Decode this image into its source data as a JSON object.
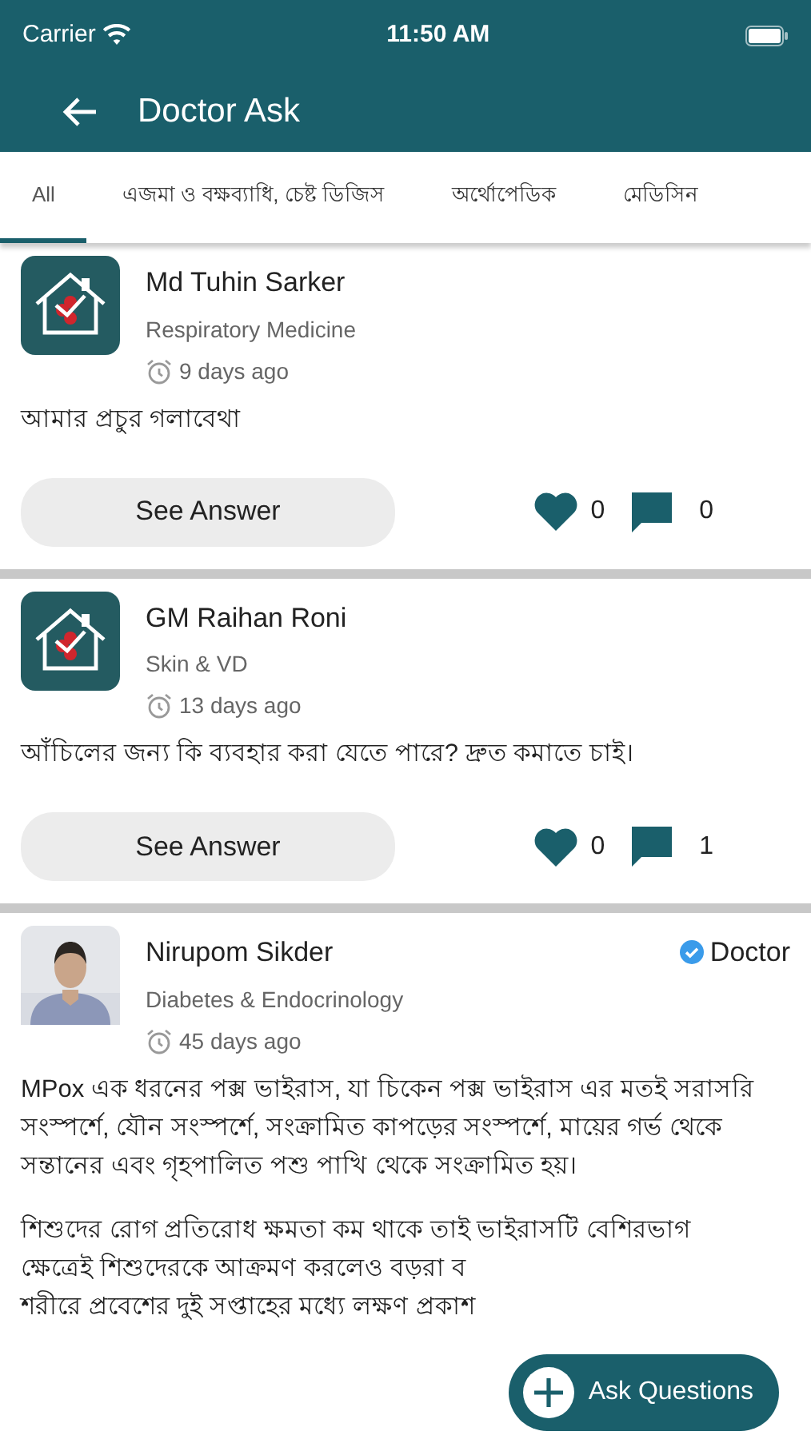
{
  "status_bar": {
    "carrier": "Carrier",
    "time": "11:50 AM"
  },
  "header": {
    "title": "Doctor Ask"
  },
  "tabs": [
    {
      "label": "All",
      "selected": true
    },
    {
      "label": "এজমা ও বক্ষব্যাধি, চেষ্ট ডিজিস",
      "selected": false
    },
    {
      "label": "অর্থোপেডিক",
      "selected": false
    },
    {
      "label": "মেডিসিন",
      "selected": false
    }
  ],
  "posts": [
    {
      "avatar": {
        "kind": "logo"
      },
      "name": "Md Tuhin Sarker",
      "specialty": "Respiratory Medicine",
      "time": "9 days ago",
      "paragraphs": [
        [
          "আমার প্রচুর গলাবেথা"
        ]
      ],
      "button": "See Answer",
      "likes": "0",
      "comments": "0"
    },
    {
      "avatar": {
        "kind": "logo"
      },
      "name": "GM Raihan Roni",
      "specialty": "Skin & VD",
      "time": "13 days ago",
      "paragraphs": [
        [
          "আঁচিলের জন্য কি ব্যবহার করা যেতে পারে? দ্রুত কমাতে চাই।"
        ]
      ],
      "button": "See Answer",
      "likes": "0",
      "comments": "1"
    },
    {
      "avatar": {
        "kind": "picture"
      },
      "name": "Nirupom  Sikder",
      "badge": "Doctor",
      "specialty": "Diabetes & Endocrinology",
      "time": "45 days ago",
      "paragraphs": [
        [
          "MPox এক ধরনের পক্স ভাইরাস, যা চিকেন পক্স ভাইরাস এর মতই সরাসরি সংস্পর্শে, যৌন সংস্পর্শে, সংক্রামিত কাপড়ের সংস্পর্শে, মায়ের গর্ভ থেকে সন্তানের এবং  গৃহপালিত পশু পাখি থেকে  সংক্রামিত হয়।"
        ],
        [
          "শিশুদের রোগ প্রতিরোধ ক্ষমতা কম থাকে তাই ভাইরাসটি বেশিরভাগ",
          "ক্ষেত্রেই শিশুদেরকে আক্রমণ করলেও বড়রা ব",
          "শরীরে প্রবেশের দুই সপ্তাহের মধ্যে লক্ষণ প্রকাশ"
        ]
      ]
    }
  ],
  "fab": {
    "label": "Ask Questions"
  }
}
